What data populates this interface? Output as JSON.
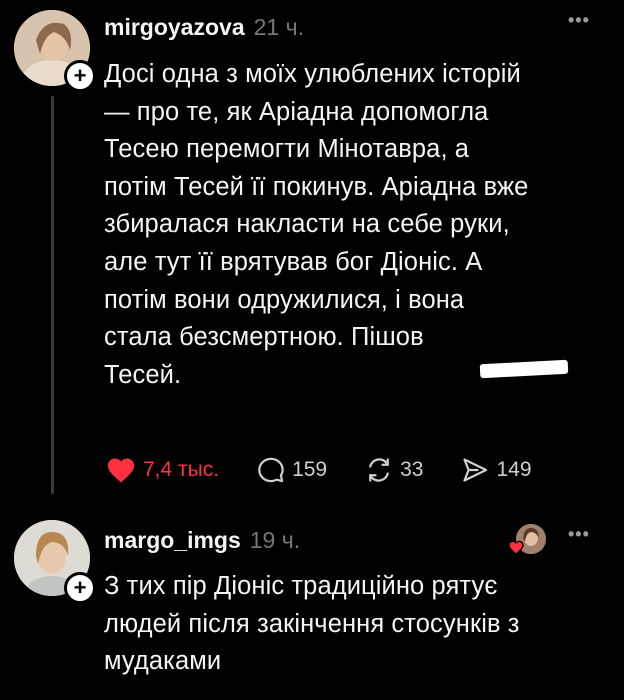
{
  "posts": [
    {
      "username": "mirgoyazova",
      "time": "21 ч.",
      "text": "Досі одна з моїх улюблених історій\n— про те, як Аріадна допомогла\nТесею перемогти Мінотавра, а\nпотім Тесей її покинув. Аріадна вже\nзбиралася накласти на себе руки,\nале тут її врятував бог Діоніс. А\nпотім вони одружилися, і вона\nстала безсмертною. Пішов\nТесей.",
      "likes": "7,4 тыс.",
      "comments": "159",
      "reposts": "33",
      "shares": "149"
    },
    {
      "username": "margo_imgs",
      "time": "19 ч.",
      "text": "З тих пір Діоніс традиційно рятує\nлюдей після закінчення стосунків з\nмудаками"
    }
  ],
  "colors": {
    "like": "#ff3040",
    "muted": "#777777",
    "text": "#f3f5f7"
  },
  "icons": [
    "heart-icon",
    "comment-icon",
    "repost-icon",
    "share-icon",
    "more-icon",
    "follow-plus-icon"
  ]
}
